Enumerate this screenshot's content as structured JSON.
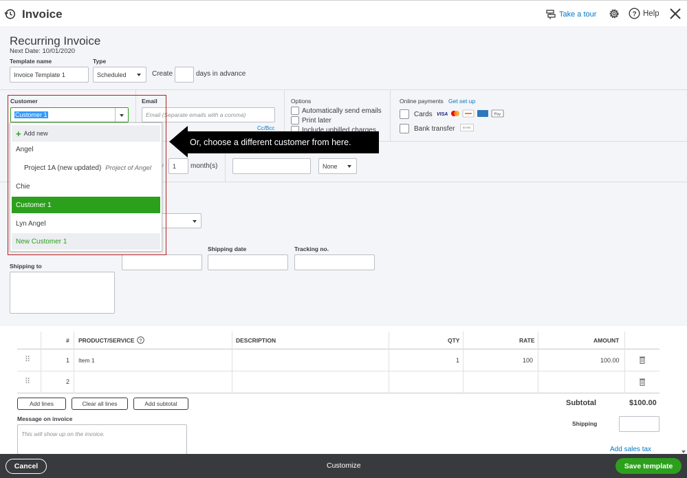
{
  "header": {
    "title": "Invoice",
    "take_tour": "Take a tour",
    "help": "Help"
  },
  "form": {
    "heading": "Recurring Invoice",
    "next_date": "Next Date: 10/01/2020",
    "template_name_label": "Template name",
    "template_name_value": "Invoice Template 1",
    "type_label": "Type",
    "type_value": "Scheduled",
    "create_label": "Create",
    "days_in_advance": "days in advance",
    "customer_label": "Customer",
    "customer_value": "Customer 1",
    "email_label": "Email",
    "email_placeholder": "Email (Separate emails with a comma)",
    "cc_bcc": "Cc/Bcc",
    "options_label": "Options",
    "option_auto_send": "Automatically send emails",
    "option_print_later": "Print later",
    "option_unbilled": "Include unbilled charges",
    "online_payments_label": "Online payments",
    "get_set_up": "Get set up",
    "cards": "Cards",
    "bank_transfer": "Bank transfer",
    "bank_badge": "BANK",
    "interval_value": "1",
    "months_label": "month(s)",
    "none_value": "None",
    "shipping_date_label": "Shipping date",
    "tracking_label": "Tracking no.",
    "shipping_to_label": "Shipping to"
  },
  "dropdown": {
    "add_new": "Add new",
    "items": [
      {
        "label": "Angel",
        "sub": ""
      },
      {
        "label": "Project 1A (new updated)",
        "sub": "Project of Angel"
      },
      {
        "label": "Chie",
        "sub": ""
      },
      {
        "label": "Customer 1",
        "sub": ""
      },
      {
        "label": "Lyn Angel",
        "sub": ""
      },
      {
        "label": "New Customer 1",
        "sub": ""
      }
    ]
  },
  "callout": {
    "text": "Or, choose a different customer from here."
  },
  "lines": {
    "headers": {
      "num": "#",
      "product": "PRODUCT/SERVICE",
      "description": "DESCRIPTION",
      "qty": "QTY",
      "rate": "RATE",
      "amount": "AMOUNT"
    },
    "rows": [
      {
        "num": "1",
        "product": "Item 1",
        "description": "",
        "qty": "1",
        "rate": "100",
        "amount": "100.00"
      },
      {
        "num": "2",
        "product": "",
        "description": "",
        "qty": "",
        "rate": "",
        "amount": ""
      }
    ],
    "add_lines": "Add lines",
    "clear_all_lines": "Clear all lines",
    "add_subtotal": "Add subtotal",
    "subtotal_label": "Subtotal",
    "subtotal_value": "$100.00",
    "shipping_label": "Shipping",
    "add_sales_tax": "Add sales tax",
    "message_label": "Message on invoice",
    "message_placeholder": "This will show up on the invoice."
  },
  "footer": {
    "cancel": "Cancel",
    "customize": "Customize",
    "save_template": "Save template"
  }
}
